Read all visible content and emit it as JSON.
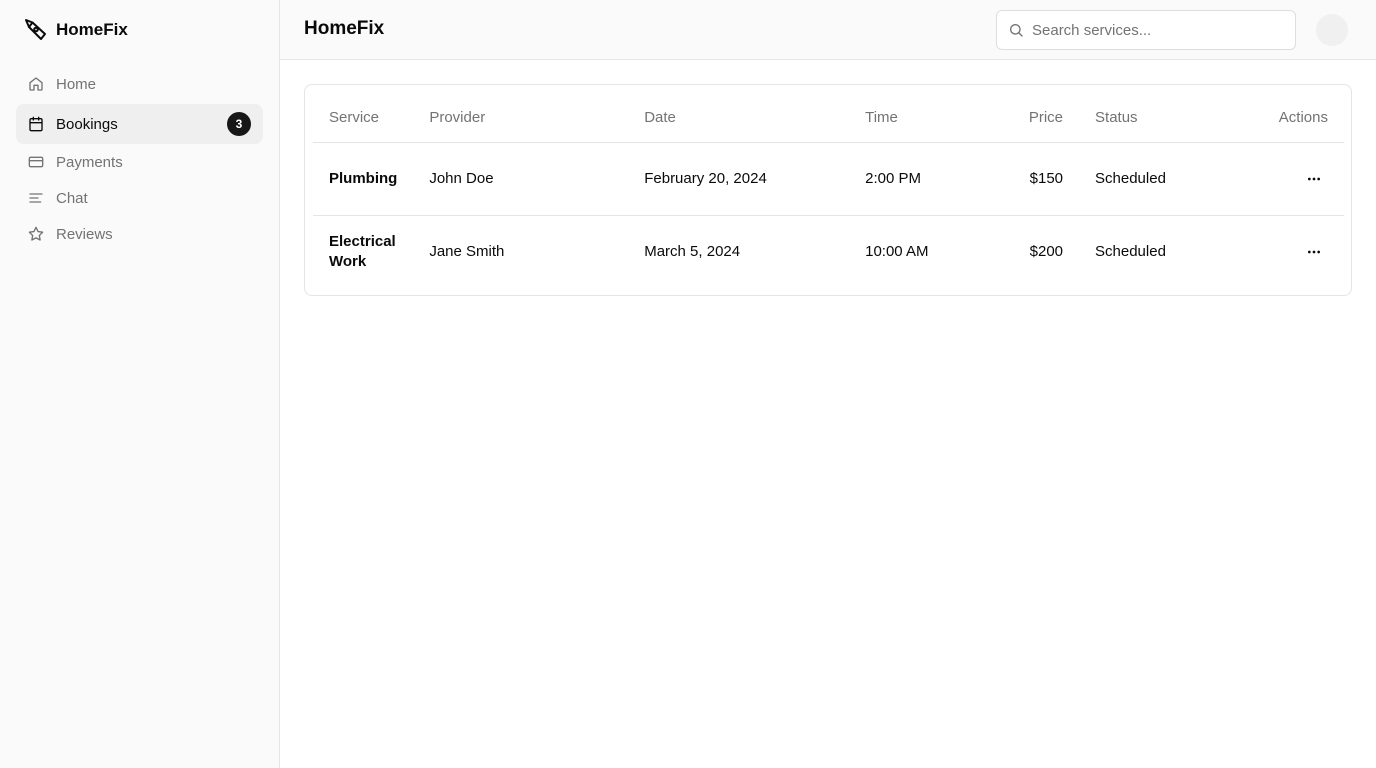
{
  "app": {
    "brand_name": "HomeFix",
    "brand_icon": "homefix-logo-icon"
  },
  "sidebar": {
    "items": [
      {
        "label": "Home",
        "icon": "home-icon",
        "active": false
      },
      {
        "label": "Bookings",
        "icon": "calendar-icon",
        "active": true,
        "badge": "3"
      },
      {
        "label": "Payments",
        "icon": "credit-card-icon",
        "active": false
      },
      {
        "label": "Chat",
        "icon": "chat-lines-icon",
        "active": false
      },
      {
        "label": "Reviews",
        "icon": "star-icon",
        "active": false
      }
    ]
  },
  "header": {
    "title": "HomeFix",
    "search_placeholder": "Search services...",
    "search_value": ""
  },
  "table": {
    "columns": [
      "Service",
      "Provider",
      "Date",
      "Time",
      "Price",
      "Status",
      "Actions"
    ],
    "rows": [
      {
        "service": "Plumbing",
        "provider": "John Doe",
        "date": "February 20, 2024",
        "time": "2:00 PM",
        "price": "$150",
        "status": "Scheduled"
      },
      {
        "service": "Electrical Work",
        "provider": "Jane Smith",
        "date": "March 5, 2024",
        "time": "10:00 AM",
        "price": "$200",
        "status": "Scheduled"
      }
    ]
  },
  "colors": {
    "sidebar_bg": "#fafafa",
    "active_bg": "#efefef",
    "badge_bg": "#171717",
    "muted_text": "#737373",
    "border": "#e5e5e5"
  }
}
